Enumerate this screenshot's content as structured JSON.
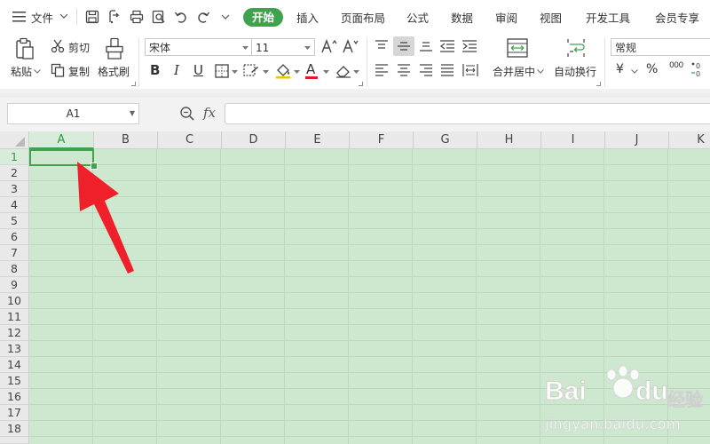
{
  "menu": {
    "file": "文件",
    "tabs": [
      "开始",
      "插入",
      "页面布局",
      "公式",
      "数据",
      "审阅",
      "视图",
      "开发工具",
      "会员专享"
    ],
    "active_tab": "开始"
  },
  "ribbon": {
    "paste": "粘贴",
    "cut": "剪切",
    "copy": "复制",
    "format_painter": "格式刷",
    "font_name": "宋体",
    "font_size": "11",
    "bold": "B",
    "italic": "I",
    "underline": "U",
    "font_color": "A",
    "merge_center": "合并居中",
    "wrap_text": "自动换行",
    "number_format": "常规",
    "currency": "¥",
    "percent": "%",
    "thousands": "000"
  },
  "formula_bar": {
    "name_box": "A1",
    "fx": "fx",
    "formula": ""
  },
  "sheet": {
    "columns": [
      "A",
      "B",
      "C",
      "D",
      "E",
      "F",
      "G",
      "H",
      "I",
      "J",
      "K"
    ],
    "rows": [
      "1",
      "2",
      "3",
      "4",
      "5",
      "6",
      "7",
      "8",
      "9",
      "10",
      "11",
      "12",
      "13",
      "14",
      "15",
      "16",
      "17",
      "18"
    ],
    "selected_column": "A",
    "selected_row": "1"
  },
  "colors": {
    "accent": "#3fa34d",
    "cell_background": "#cde8cf",
    "arrow": "#f0202a"
  },
  "watermark": {
    "logo_text": "Bai",
    "logo_suffix": "du",
    "brand_cn": "经验",
    "url": "jingyan.baidu.com"
  }
}
